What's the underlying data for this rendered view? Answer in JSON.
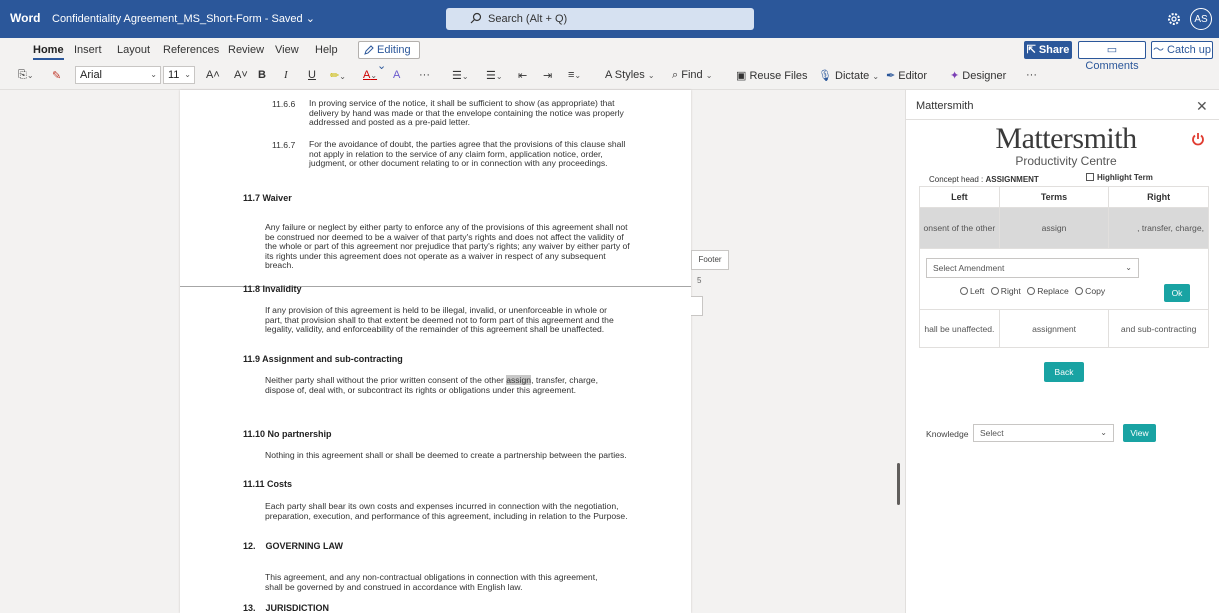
{
  "titlebar": {
    "app": "Word",
    "doc_title": "Confidentiality Agreement_MS_Short-Form - Saved ⌄",
    "search_placeholder": "Search (Alt + Q)",
    "avatar_initials": "AS"
  },
  "ribbon": {
    "tabs": [
      "Home",
      "Insert",
      "Layout",
      "References",
      "Review",
      "View",
      "Help"
    ],
    "editing_label": "Editing ⌄",
    "share_label": "Share",
    "comments_label": "Comments",
    "catchup_label": "Catch up",
    "font_name": "Arial",
    "font_size": "11",
    "styles_label": "Styles",
    "find_label": "Find",
    "reuse_label": "Reuse Files",
    "dictate_label": "Dictate",
    "editor_label": "Editor",
    "designer_label": "Designer",
    "more_label": "···"
  },
  "document": {
    "p1166_num": "11.6.6",
    "p1166": "In proving service of the notice, it shall be sufficient to show (as appropriate) that delivery by hand was made or that the envelope containing the notice was properly addressed and posted as a pre-paid letter.",
    "p1167_num": "11.6.7",
    "p1167": "For the avoidance of doubt, the parties agree that the provisions of this clause shall not apply in relation to the service of any claim form, application notice, order, judgment, or other document relating to or in connection with any proceedings.",
    "h117": "11.7  Waiver",
    "p117": "Any failure or neglect by either party to enforce any of the provisions of this agreement shall not be construed nor deemed to be a waiver of that party's rights and does not affect the validity of the whole or part of this agreement nor prejudice that party's rights; any waiver by either party of its rights under this agreement does not operate as a waiver in respect of any subsequent breach.",
    "h118": "11.8  Invalidity",
    "p118": "If any provision of this agreement is held to be illegal, invalid, or unenforceable in whole or part, that provision shall to that extent be deemed not to form part of this agreement and the legality, validity, and enforceability of the remainder of this agreement shall be unaffected.",
    "h119": "11.9  Assignment and sub-contracting",
    "p119_a": "Neither party shall without the prior written consent of the other ",
    "p119_hl": "assign",
    "p119_b": ", transfer, charge, dispose of, deal with, or subcontract its rights or obligations under this agreement.",
    "h1110": "11.10 No partnership",
    "p1110": "Nothing in this agreement shall or shall be deemed to create a partnership between the parties.",
    "h1111": "11.11 Costs",
    "p1111": "Each party shall bear its own costs and expenses incurred in connection with the negotiation, preparation, execution, and performance of this agreement, including in relation to the Purpose.",
    "h12": "12.    GOVERNING LAW",
    "p12": "This agreement, and any non-contractual obligations in connection with this agreement, shall be governed by and construed in accordance with English law.",
    "h13": "13.    JURISDICTION",
    "footer_label": "Footer",
    "footer_num": "5"
  },
  "panel": {
    "title": "Mattersmith",
    "brand": "Mattersmith",
    "brand_sub": "Productivity Centre",
    "concept_label": "Concept head : ",
    "concept_value": "ASSIGNMENT",
    "highlight_label": "Highlight Term",
    "columns": [
      "Left",
      "Terms",
      "Right"
    ],
    "row1": {
      "left": "onsent of the other",
      "term": "assign",
      "right": ", transfer, charge,"
    },
    "amend_placeholder": "Select Amendment",
    "radios": [
      "Left",
      "Right",
      "Replace",
      "Copy"
    ],
    "ok_label": "Ok",
    "row2": {
      "left": "hall be unaffected.",
      "term": "assignment",
      "right": "and sub-contracting"
    },
    "back_label": "Back",
    "knowledge_label": "Knowledge",
    "knowledge_placeholder": "Select",
    "view_label": "View"
  },
  "colors": {
    "word_blue": "#2b579a",
    "teal": "#19a3a3",
    "link": "#2f7fd2"
  }
}
